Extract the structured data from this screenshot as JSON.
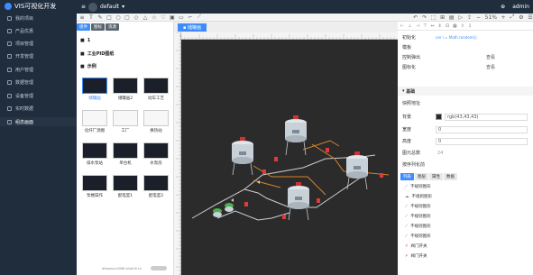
{
  "app": {
    "title": "VIS可视化开发",
    "project": "default",
    "user": "admin"
  },
  "sidebar": {
    "items": [
      {
        "label": "我的项目"
      },
      {
        "label": "产品优惠"
      },
      {
        "label": "项目管理"
      },
      {
        "label": "开发管理"
      },
      {
        "label": "用户管理"
      },
      {
        "label": "数据管理"
      },
      {
        "label": "设备管理"
      },
      {
        "label": "实时数据"
      },
      {
        "label": "组态画面"
      }
    ]
  },
  "toolbar": {
    "zoom": "51%"
  },
  "library": {
    "tabs": [
      "组件",
      "图标",
      "资源"
    ],
    "tree_root": "1",
    "group_title": "工业PID图纸",
    "example_title": "示例",
    "items": [
      "储罐画",
      "储罐画2",
      "动车工艺",
      "化纤厂源图",
      "工厂",
      "换热站",
      "排水泵站",
      "单台机",
      "水泵房",
      "泵楼操作",
      "配电室1",
      "配电室2"
    ],
    "footer": "dfwaepcc0068.blub26.cn"
  },
  "canvas": {
    "tab": "储罐画"
  },
  "props": {
    "rows": [
      {
        "label": "初始化",
        "value": "var i = Math.random();"
      },
      {
        "label": "模板",
        "value": ""
      },
      {
        "label": "控制弹出",
        "value": "查看"
      },
      {
        "label": "图标化",
        "value": "查看"
      }
    ],
    "basic_section": "基础",
    "basic": [
      {
        "label": "快照地址",
        "value": ""
      },
      {
        "label": "背景",
        "value": "rgb(43,43,43)"
      },
      {
        "label": "宽度",
        "value": "0"
      },
      {
        "label": "高度",
        "value": "0"
      },
      {
        "label": "图元总数",
        "value": "24"
      },
      {
        "label": "按序列化前",
        "value": ""
      }
    ],
    "subtabs": [
      "列表",
      "图层",
      "属性",
      "数据"
    ],
    "list": [
      {
        "icon": "line",
        "label": "不规则图形"
      },
      {
        "icon": "pump",
        "label": "不规则图形"
      },
      {
        "icon": "line",
        "label": "不规则图形"
      },
      {
        "icon": "line",
        "label": "不规则图形"
      },
      {
        "icon": "line",
        "label": "不规则图形"
      },
      {
        "icon": "line",
        "label": "不规则图形"
      },
      {
        "icon": "valve",
        "label": "阀门开关"
      },
      {
        "icon": "valve",
        "label": "阀门开关"
      }
    ]
  }
}
